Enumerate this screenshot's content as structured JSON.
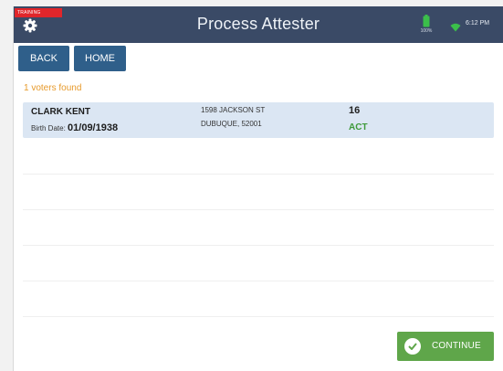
{
  "header": {
    "training_label": "TRAINING",
    "title": "Process Attester",
    "battery_percent": "100%",
    "time": "6:12 PM",
    "icons": [
      "gear-icon",
      "battery-icon",
      "wifi-icon"
    ]
  },
  "toolbar": {
    "back_label": "BACK",
    "home_label": "HOME"
  },
  "results": {
    "count_text": "1 voters found"
  },
  "voters": [
    {
      "name": "CLARK KENT",
      "birth_label": "Birth Date:",
      "birth_date": "01/09/1938",
      "address_line1": "1598 JACKSON ST",
      "address_line2": "DUBUQUE, 52001",
      "number": "16",
      "status": "ACT"
    }
  ],
  "footer": {
    "continue_label": "CONTINUE"
  },
  "colors": {
    "header_bg": "#3a4a66",
    "button_bg": "#2f5f8a",
    "row_highlight": "#dbe6f3",
    "count_text": "#e79a2b",
    "status_active": "#3e9a3a",
    "continue_bg": "#5fa64a",
    "training_badge": "#e0262b"
  }
}
